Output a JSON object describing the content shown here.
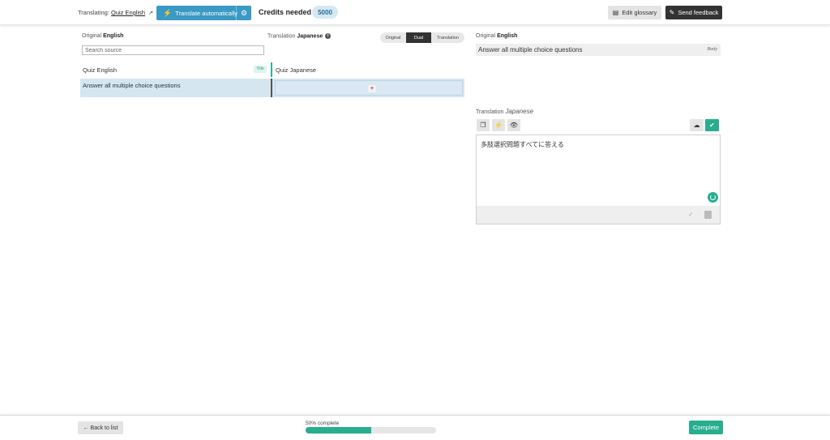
{
  "header": {
    "translating_prefix": "Translating:",
    "translating_link": "Quiz English",
    "external_icon": "external-link-icon",
    "translate_auto_label": "Translate automatically",
    "credits_label": "Credits needed",
    "credits_value": "5000",
    "edit_glossary_label": "Edit glossary",
    "send_feedback_label": "Send feedback"
  },
  "left_panel": {
    "original_prefix": "Original",
    "original_lang": "English",
    "translation_prefix": "Translation",
    "translation_lang": "Japanese",
    "view_toggle": {
      "original": "Original",
      "dual": "Dual",
      "translation": "Translation",
      "selected": "Dual"
    },
    "search_placeholder": "Search source",
    "rows": [
      {
        "source": "Quiz English",
        "badge": "Title",
        "translation": "Quiz Japanese"
      },
      {
        "source": "Answer all multiple choice questions",
        "add_label": "+",
        "translation": ""
      }
    ]
  },
  "right_panel": {
    "original_prefix": "Original",
    "original_lang": "English",
    "source_text": "Answer all multiple choice questions",
    "body_tag": "Body",
    "translation_prefix": "Translation",
    "translation_lang": "Japanese",
    "editor_text": "多肢選択問題すべてに答える"
  },
  "footer": {
    "back_label": "← Back to list",
    "progress_label": "50% complete",
    "progress_fraction": 0.5,
    "complete_label": "Complete"
  },
  "colors": {
    "accent_green": "#27ae8f",
    "accent_blue": "#3b9ac4",
    "selected_row": "#d5e6f1"
  }
}
